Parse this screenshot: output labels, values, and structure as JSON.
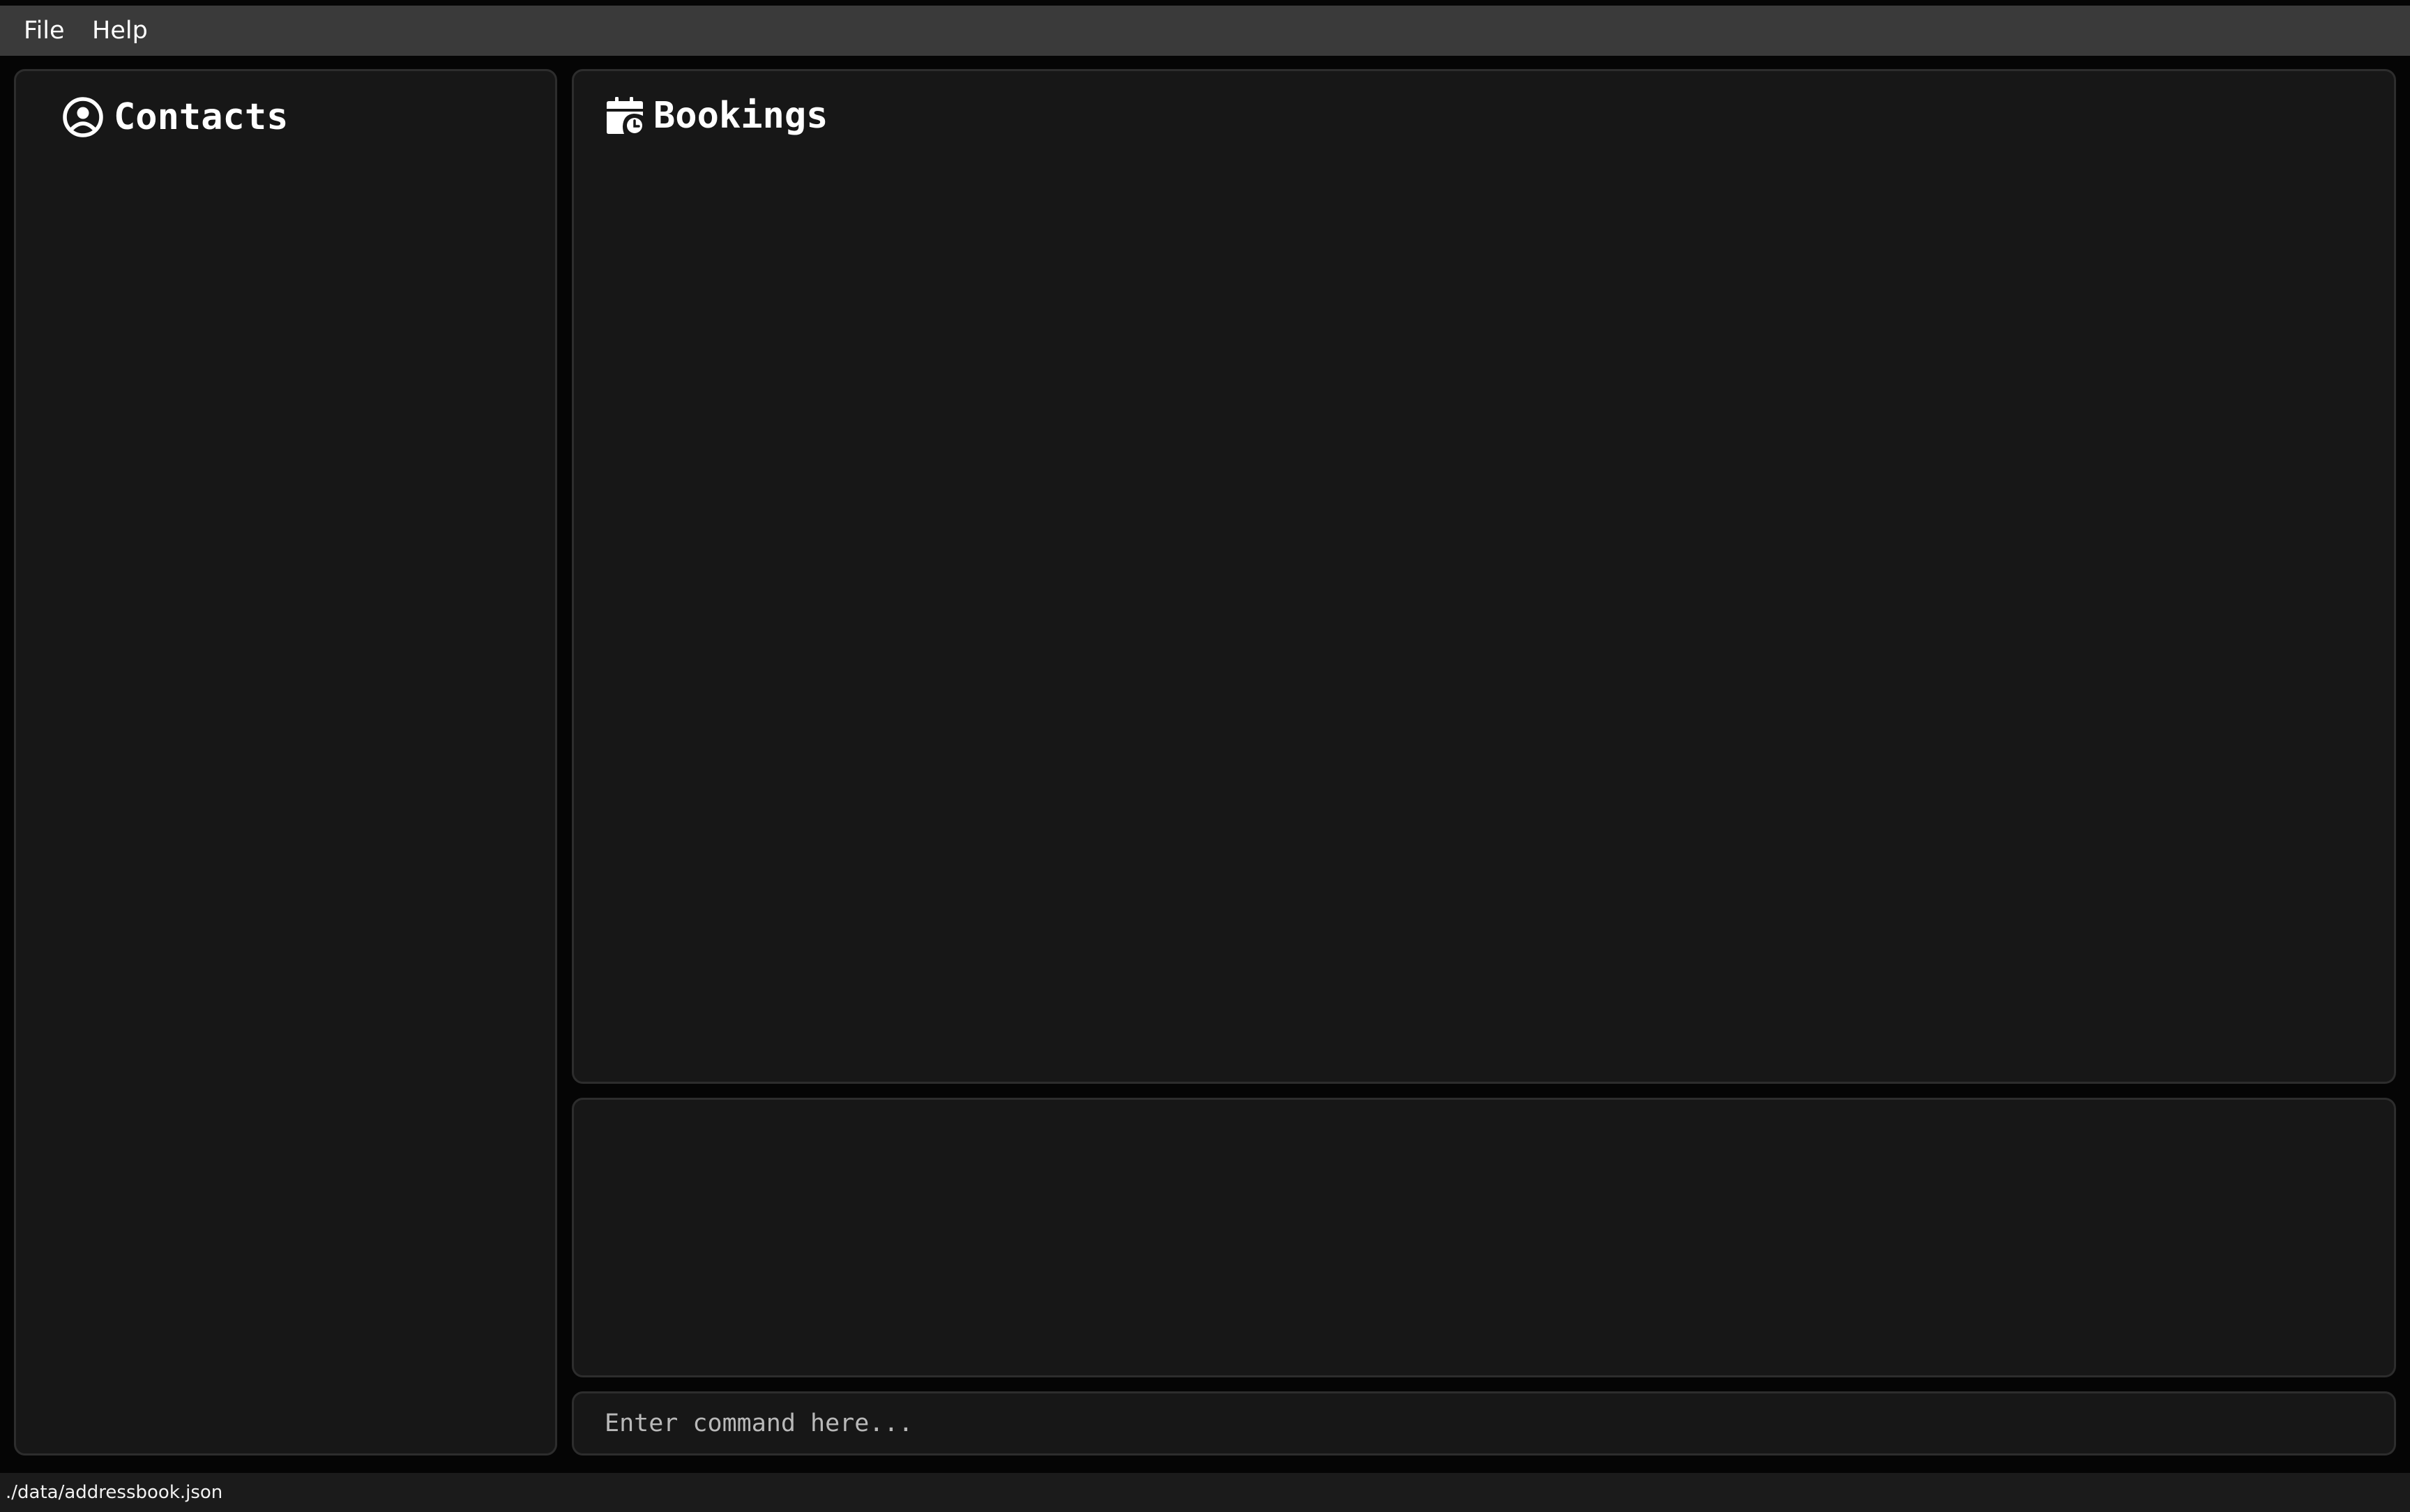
{
  "menu": {
    "file_label": "File",
    "help_label": "Help"
  },
  "contacts_panel": {
    "title": "Contacts",
    "icon": "user-circle-icon"
  },
  "bookings_panel": {
    "title": "Bookings",
    "icon": "calendar-clock-icon"
  },
  "result_display": {
    "text": ""
  },
  "command_box": {
    "value": "",
    "placeholder": "Enter command here..."
  },
  "status_bar": {
    "file_path": "./data/addressbook.json"
  },
  "colors": {
    "menubar_bg": "#3a3a3a",
    "panel_bg": "#171717",
    "panel_border": "#2d2d2d",
    "text": "#ffffff",
    "statusbar_bg": "#1b1b1b"
  }
}
